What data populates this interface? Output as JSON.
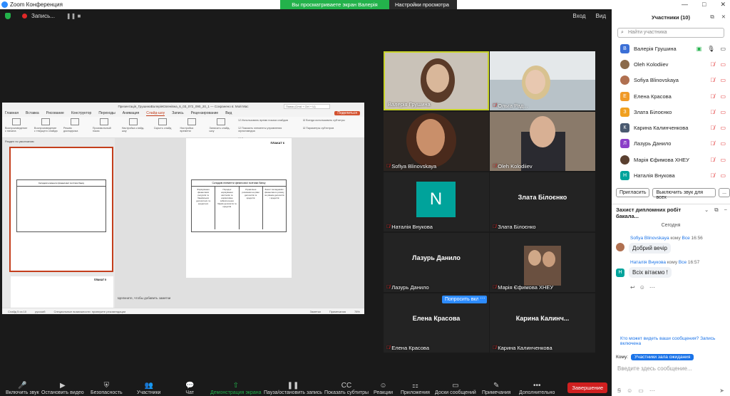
{
  "window": {
    "app_title": "Zoom Конференция",
    "win_controls": [
      "—",
      "□",
      "✕"
    ]
  },
  "share_banner": {
    "viewing": "Вы просматриваете экран Валерія Грушина",
    "options": "Настройки просмотра"
  },
  "topbar": {
    "record_label": "Запись...",
    "pause_icon": "❚❚ ■",
    "enter": "Вход",
    "view": "Вид"
  },
  "ppt": {
    "title": "Презентація_ГрушинаВалеріяЄвгенівна_6_03_072_090_20_1 — Сохранено в: Мой Mac",
    "search": "Поиск (Cmd + Ctrl + U)",
    "menu": [
      "Главная",
      "Вставка",
      "Рисование",
      "Конструктор",
      "Переходы",
      "Анимация",
      "Слайд-шоу",
      "Запись",
      "Рецензирование",
      "Вид"
    ],
    "active_menu": "Слайд-шоу",
    "record_btn": "Запись",
    "comments_btn": "Примечания",
    "share_btn": "Поделиться",
    "ribbon_buttons": [
      "Воспроизведение с начала",
      "Воспроизведение с текущего слайда",
      "Режим докладчика",
      "Произвольный показ",
      "Настройка слайд-шоу",
      "Скрыть слайд",
      "Настройка времени",
      "Записать слайд-шоу"
    ],
    "ribbon_checks": [
      "Использовать время показа слайдов",
      "Показать элементы управления мультимедиа",
      "Воспроизвести речевое сопровождение"
    ],
    "ribbon_right": [
      "Всегда использовать субтитры",
      "Параметры субтитров"
    ],
    "sections_label": "Раздел по умолчанию",
    "slide_plan": "ПЛАКАТ 6",
    "slide_table_title": "Складові елементи фінансової політики банку",
    "slide_table_cols": [
      "Формування фінансових ресурсів та банківських депозитних та кредитних",
      "Порядок нормування капіталів та нормативне забезпечення банків депозитів та кредитів",
      "Управління ризиками на рівні депозитів та кредитів",
      "Захист вкладників і фінансового ризику за рівнем депозитів і кредитів"
    ],
    "next_thumb_plan": "ПЛАКАТ 5",
    "notes_placeholder": "Щелкните, чтобы добавить заметки",
    "status": [
      "Слайд 5 из 10",
      "русский",
      "Специальные возможности: проверите рекомендации",
      "Заметки",
      "Примечания",
      "78%"
    ]
  },
  "tiles": [
    {
      "name": "Валерія Грушина",
      "muted": false,
      "speaker": true
    },
    {
      "name": "Ольга Рад...",
      "muted": true
    },
    {
      "name": "Sofiya Blinovskaya",
      "muted": true
    },
    {
      "name": "Oleh Kolodiiev",
      "muted": true
    },
    {
      "name": "Наталія Внукова",
      "muted": true,
      "avatar": "N"
    },
    {
      "name": "Злата Білоєнко",
      "muted": true,
      "big": "Злата Білоєнко"
    },
    {
      "name": "Лазурь Данило",
      "muted": true,
      "big": "Лазурь Данило"
    },
    {
      "name": "Марія Єфимова ХНЕУ",
      "muted": true
    },
    {
      "name": "Елена Красова",
      "muted": true,
      "big": "Елена Красова"
    },
    {
      "name": "Карина Калинченкова",
      "muted": true,
      "big": "Карина  Калинч..."
    }
  ],
  "ask_unmute": "Попросить вкл",
  "toolbar": [
    {
      "icon": "🎤",
      "label": "Включить звук"
    },
    {
      "icon": "▶",
      "label": "Остановить видео"
    },
    {
      "icon": "⛨",
      "label": "Безопасность"
    },
    {
      "icon": "👥",
      "label": "Участники",
      "count": "10"
    },
    {
      "icon": "💬",
      "label": "Чат"
    },
    {
      "icon": "⇧",
      "label": "Демонстрация экрана"
    },
    {
      "icon": "❚❚",
      "label": "Пауза/остановить запись"
    },
    {
      "icon": "CC",
      "label": "Показать субтитры"
    },
    {
      "icon": "☺",
      "label": "Реакции"
    },
    {
      "icon": "⚏",
      "label": "Приложения"
    },
    {
      "icon": "▭",
      "label": "Доски сообщений"
    },
    {
      "icon": "✎",
      "label": "Примечания"
    },
    {
      "icon": "•••",
      "label": "Дополнительно"
    }
  ],
  "end_button": "Завершение",
  "participants": {
    "header": "Участники (10)",
    "search_placeholder": "Найти участника",
    "list": [
      {
        "initial": "В",
        "name": "Валерія Грушина",
        "color": "#3b6fd6",
        "mic": "on"
      },
      {
        "initial": "",
        "name": "Oleh Kolodiiev",
        "color": "#8a6a4a",
        "mic": "off"
      },
      {
        "initial": "",
        "name": "Sofiya Blinovskaya",
        "color": "#b07050",
        "mic": "off"
      },
      {
        "initial": "Е",
        "name": "Елена Красова",
        "color": "#f09a28",
        "mic": "off"
      },
      {
        "initial": "З",
        "name": "Злата Білоєнко",
        "color": "#f0a020",
        "mic": "off"
      },
      {
        "initial": "К",
        "name": "Карина Калинченкова",
        "color": "#4a5a70",
        "mic": "off"
      },
      {
        "initial": "Л",
        "name": "Лазурь Данило",
        "color": "#8b3fc8",
        "mic": "off"
      },
      {
        "initial": "",
        "name": "Марія Єфимова ХНЕУ",
        "color": "#5a4030",
        "mic": "off"
      },
      {
        "initial": "Н",
        "name": "Наталія Внукова",
        "color": "#00a39b",
        "mic": "off"
      }
    ],
    "invite_btn": "Пригласить",
    "mute_all_btn": "Выключить звук для всех",
    "more_btn": "..."
  },
  "chat": {
    "title": "Захист дипломних робіт бакала...",
    "today": "Сегодня",
    "messages": [
      {
        "sender": "Sofiya Blinovskaya",
        "to": "кому",
        "to_who": "Все",
        "time": "16:56",
        "text": "Добрий вечір"
      },
      {
        "sender": "Наталія Внукова",
        "to": "кому",
        "to_who": "Все",
        "time": "16:57",
        "text": "Всіх вітаємо !"
      }
    ],
    "notice": "Кто может видеть ваши сообщения? Запись включена",
    "to_label": "Кому:",
    "to_value": "Участники зала ожидания",
    "input_placeholder": "Введите здесь сообщение..."
  }
}
